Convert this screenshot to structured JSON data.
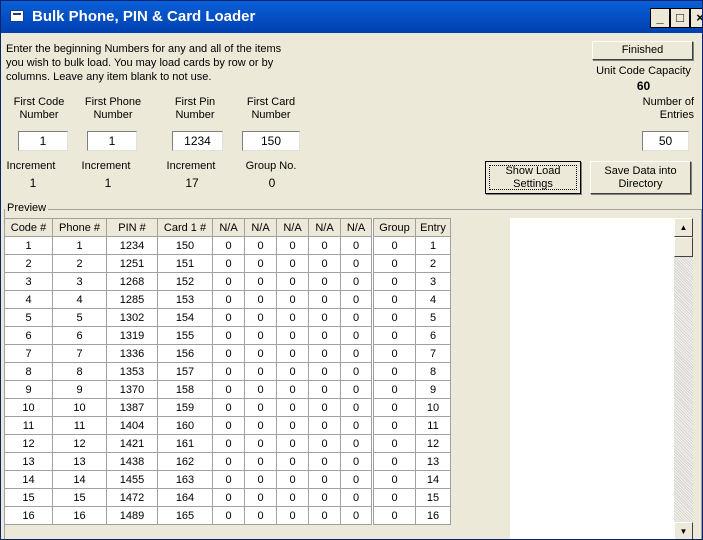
{
  "window": {
    "title": "Bulk Phone, PIN & Card Loader",
    "controls": [
      "_",
      "□",
      "×"
    ]
  },
  "instructions": [
    "Enter the beginning Numbers for any and all of the items",
    "you wish to bulk load.  You may load cards by row or by",
    "columns.  Leave any item blank to not use."
  ],
  "fields": {
    "first_code": {
      "label1": "First Code",
      "label2": "Number",
      "value": "1"
    },
    "first_phone": {
      "label1": "First Phone",
      "label2": "Number",
      "value": "1"
    },
    "first_pin": {
      "label1": "First Pin",
      "label2": "Number",
      "value": "1234"
    },
    "first_card": {
      "label1": "First Card",
      "label2": "Number",
      "value": "150"
    },
    "num_entries": {
      "label1": "Number of",
      "label2": "Entries",
      "value": "50"
    }
  },
  "increments": {
    "code": {
      "label": "Increment",
      "value": "1"
    },
    "phone": {
      "label": "Increment",
      "value": "1"
    },
    "pin": {
      "label": "Increment",
      "value": "17"
    },
    "group": {
      "label": "Group No.",
      "value": "0"
    }
  },
  "buttons": {
    "finished": "Finished",
    "show_load_1": "Show Load",
    "show_load_2": "Settings",
    "save_1": "Save Data into",
    "save_2": "Directory"
  },
  "capacity": {
    "label": "Unit Code Capacity",
    "value": "60"
  },
  "preview": {
    "label": "Preview",
    "columns": [
      "Code #",
      "Phone #",
      "PIN #",
      "Card 1 #",
      "N/A",
      "N/A",
      "N/A",
      "N/A",
      "N/A",
      "Group",
      "Entry"
    ],
    "rows": [
      [
        "1",
        "1",
        "1234",
        "150",
        "0",
        "0",
        "0",
        "0",
        "0",
        "0",
        "1"
      ],
      [
        "2",
        "2",
        "1251",
        "151",
        "0",
        "0",
        "0",
        "0",
        "0",
        "0",
        "2"
      ],
      [
        "3",
        "3",
        "1268",
        "152",
        "0",
        "0",
        "0",
        "0",
        "0",
        "0",
        "3"
      ],
      [
        "4",
        "4",
        "1285",
        "153",
        "0",
        "0",
        "0",
        "0",
        "0",
        "0",
        "4"
      ],
      [
        "5",
        "5",
        "1302",
        "154",
        "0",
        "0",
        "0",
        "0",
        "0",
        "0",
        "5"
      ],
      [
        "6",
        "6",
        "1319",
        "155",
        "0",
        "0",
        "0",
        "0",
        "0",
        "0",
        "6"
      ],
      [
        "7",
        "7",
        "1336",
        "156",
        "0",
        "0",
        "0",
        "0",
        "0",
        "0",
        "7"
      ],
      [
        "8",
        "8",
        "1353",
        "157",
        "0",
        "0",
        "0",
        "0",
        "0",
        "0",
        "8"
      ],
      [
        "9",
        "9",
        "1370",
        "158",
        "0",
        "0",
        "0",
        "0",
        "0",
        "0",
        "9"
      ],
      [
        "10",
        "10",
        "1387",
        "159",
        "0",
        "0",
        "0",
        "0",
        "0",
        "0",
        "10"
      ],
      [
        "11",
        "11",
        "1404",
        "160",
        "0",
        "0",
        "0",
        "0",
        "0",
        "0",
        "11"
      ],
      [
        "12",
        "12",
        "1421",
        "161",
        "0",
        "0",
        "0",
        "0",
        "0",
        "0",
        "12"
      ],
      [
        "13",
        "13",
        "1438",
        "162",
        "0",
        "0",
        "0",
        "0",
        "0",
        "0",
        "13"
      ],
      [
        "14",
        "14",
        "1455",
        "163",
        "0",
        "0",
        "0",
        "0",
        "0",
        "0",
        "14"
      ],
      [
        "15",
        "15",
        "1472",
        "164",
        "0",
        "0",
        "0",
        "0",
        "0",
        "0",
        "15"
      ],
      [
        "16",
        "16",
        "1489",
        "165",
        "0",
        "0",
        "0",
        "0",
        "0",
        "0",
        "16"
      ]
    ]
  },
  "colors": {
    "titlebar": "#0050c8",
    "face": "#ece9d8"
  },
  "icons": {
    "app": "window-icon",
    "scroll_up": "arrow-up-icon",
    "scroll_down": "arrow-down-icon"
  }
}
